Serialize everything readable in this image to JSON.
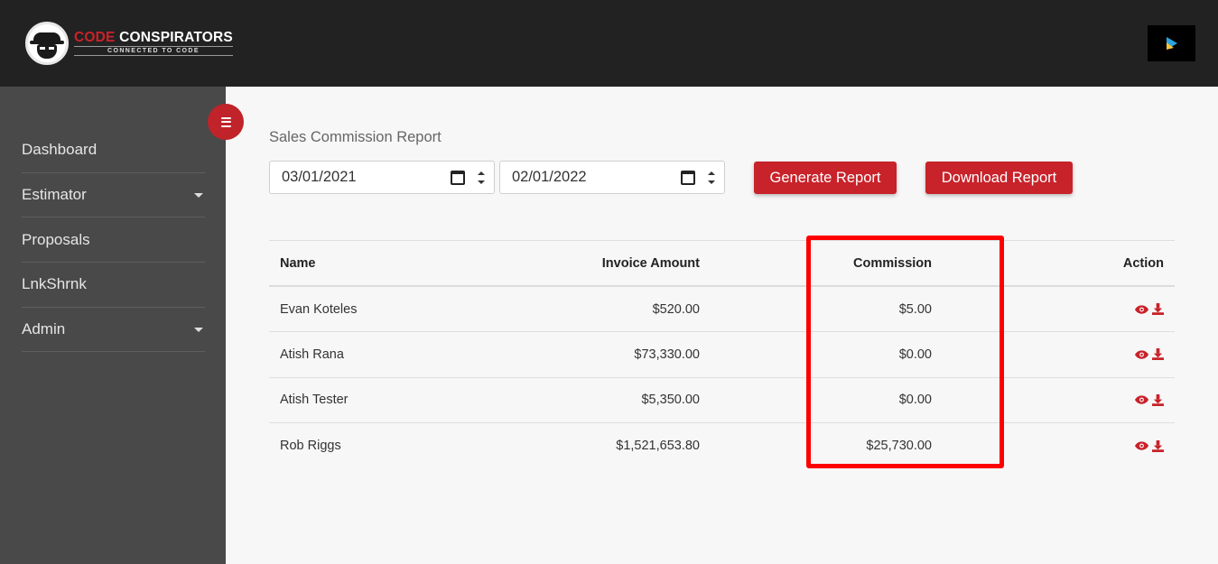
{
  "brand": {
    "name_part1": "CODE",
    "name_part2": "CONSPIRATORS",
    "tagline": "CONNECTED TO CODE",
    "accent": "#cc2229"
  },
  "header": {
    "store_icon": "google-play-icon"
  },
  "sidebar": {
    "toggle_icon": "hamburger-icon",
    "items": [
      {
        "label": "Dashboard",
        "has_submenu": false
      },
      {
        "label": "Estimator",
        "has_submenu": true
      },
      {
        "label": "Proposals",
        "has_submenu": false
      },
      {
        "label": "LnkShrnk",
        "has_submenu": false
      },
      {
        "label": "Admin",
        "has_submenu": true
      }
    ]
  },
  "report": {
    "title": "Sales Commission Report",
    "start_date": "03/01/2021",
    "end_date": "02/01/2022",
    "generate_label": "Generate Report",
    "download_label": "Download Report"
  },
  "table": {
    "headers": {
      "name": "Name",
      "invoice_amount": "Invoice Amount",
      "commission": "Commission",
      "action": "Action"
    },
    "rows": [
      {
        "name": "Evan Koteles",
        "invoice_amount": "$520.00",
        "commission": "$5.00"
      },
      {
        "name": "Atish Rana",
        "invoice_amount": "$73,330.00",
        "commission": "$0.00"
      },
      {
        "name": "Atish Tester",
        "invoice_amount": "$5,350.00",
        "commission": "$0.00"
      },
      {
        "name": "Rob Riggs",
        "invoice_amount": "$1,521,653.80",
        "commission": "$25,730.00"
      }
    ],
    "action_icons": [
      "eye-icon",
      "download-icon"
    ]
  }
}
